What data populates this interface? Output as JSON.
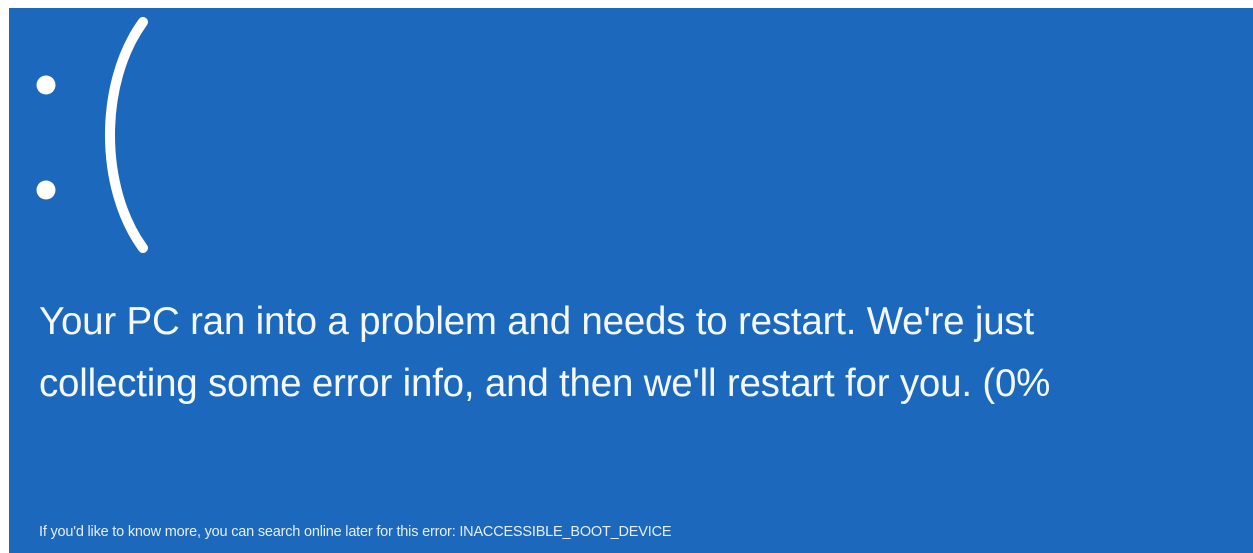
{
  "screen": {
    "background_color": "#1b68bd",
    "text_color": "#ffffff",
    "emoticon": ":(",
    "message_line_1": "Your PC ran into a problem and needs to restart. We're just",
    "message_line_2": "collecting some error info, and then we'll restart for you. (0%",
    "info_text": "If you'd like to know more, you can search online later for this error: INACCESSIBLE_BOOT_DEVICE"
  }
}
